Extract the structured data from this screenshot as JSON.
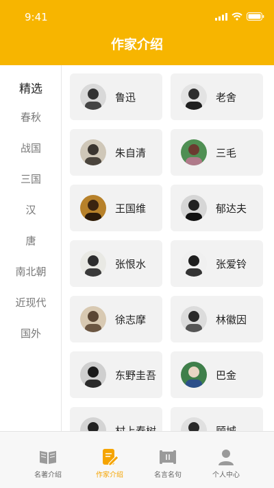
{
  "status": {
    "time": "9:41"
  },
  "header": {
    "title": "作家介绍"
  },
  "sidebar": {
    "items": [
      "精选",
      "春秋",
      "战国",
      "三国",
      "汉",
      "唐",
      "南北朝",
      "近现代",
      "国外"
    ],
    "selected_index": 0
  },
  "authors": [
    {
      "name": "鲁迅",
      "avatar": "portrait-lu-xun"
    },
    {
      "name": "老舍",
      "avatar": "portrait-lao-she"
    },
    {
      "name": "朱自清",
      "avatar": "portrait-zhu-ziqing"
    },
    {
      "name": "三毛",
      "avatar": "portrait-san-mao"
    },
    {
      "name": "王国维",
      "avatar": "portrait-wang-guowei"
    },
    {
      "name": "郁达夫",
      "avatar": "portrait-yu-dafu"
    },
    {
      "name": "张恨水",
      "avatar": "portrait-zhang-henshui"
    },
    {
      "name": "张爱铃",
      "avatar": "portrait-zhang-ailing"
    },
    {
      "name": "徐志摩",
      "avatar": "portrait-xu-zhimo"
    },
    {
      "name": "林徽因",
      "avatar": "portrait-lin-huiyin"
    },
    {
      "name": "东野圭吾",
      "avatar": "portrait-higashino-keigo"
    },
    {
      "name": "巴金",
      "avatar": "portrait-ba-jin"
    },
    {
      "name": "村上春树",
      "avatar": "portrait-murakami-haruki"
    },
    {
      "name": "顾城",
      "avatar": "portrait-gu-cheng"
    }
  ],
  "tabbar": {
    "items": [
      {
        "label": "名著介绍",
        "icon": "book-icon"
      },
      {
        "label": "作家介绍",
        "icon": "pen-document-icon"
      },
      {
        "label": "名言名句",
        "icon": "scroll-icon"
      },
      {
        "label": "个人中心",
        "icon": "person-icon"
      }
    ],
    "active_index": 1
  },
  "colors": {
    "accent": "#f7b500",
    "card_bg": "#f2f2f2",
    "active_tab": "#f5a400"
  }
}
